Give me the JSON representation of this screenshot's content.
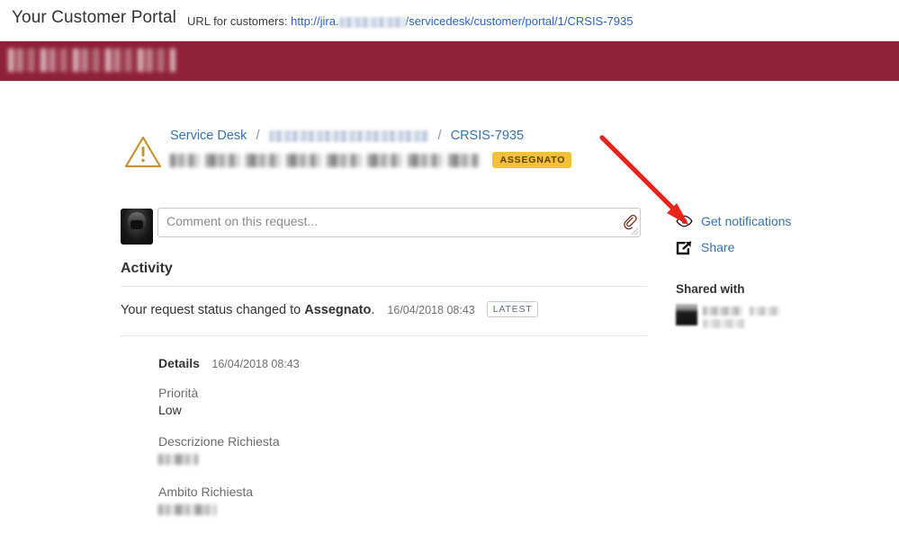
{
  "header": {
    "portal_title": "Your Customer Portal",
    "url_label": "URL for customers:",
    "url_prefix": "http://jira.",
    "url_suffix": "/servicedesk/customer/portal/1/CRSIS-7935",
    "link_color": "#2a62c4"
  },
  "banner": {
    "background_color": "#8e2038",
    "logo_alt": "company-logo-redacted"
  },
  "request": {
    "type_icon": "warning-triangle-icon",
    "breadcrumb": {
      "root": "Service Desk",
      "separator": "/",
      "project": "",
      "issue_key": "CRSIS-7935"
    },
    "summary_redacted": "",
    "status": "ASSEGNATO",
    "status_color": "#f5c039",
    "status_text_color": "#594300"
  },
  "comment": {
    "placeholder": "Comment on this request...",
    "value": "",
    "attach_icon": "paperclip-icon",
    "avatar_alt": "user-avatar"
  },
  "activity": {
    "title": "Activity",
    "entry_prefix": "Your request status changed to ",
    "entry_status": "Assegnato",
    "entry_suffix": ".",
    "timestamp": "16/04/2018 08:43",
    "latest_badge": "LATEST"
  },
  "details": {
    "label": "Details",
    "timestamp": "16/04/2018 08:43",
    "fields": [
      {
        "label": "Priorità",
        "value": "Low",
        "redacted": false,
        "redact_width": 0
      },
      {
        "label": "Descrizione Richiesta",
        "value": "",
        "redacted": true,
        "redact_width": 44
      },
      {
        "label": "Ambito Richiesta",
        "value": "",
        "redacted": true,
        "redact_width": 64
      }
    ]
  },
  "sidebar": {
    "actions": [
      {
        "label": "Get notifications",
        "icon": "eye-icon"
      },
      {
        "label": "Share",
        "icon": "share-icon"
      }
    ],
    "shared_with_title": "Shared with",
    "shared_with_person": ""
  },
  "annotation": {
    "arrow_color": "#e8241c",
    "points_to": "get-notifications-eye-icon"
  }
}
